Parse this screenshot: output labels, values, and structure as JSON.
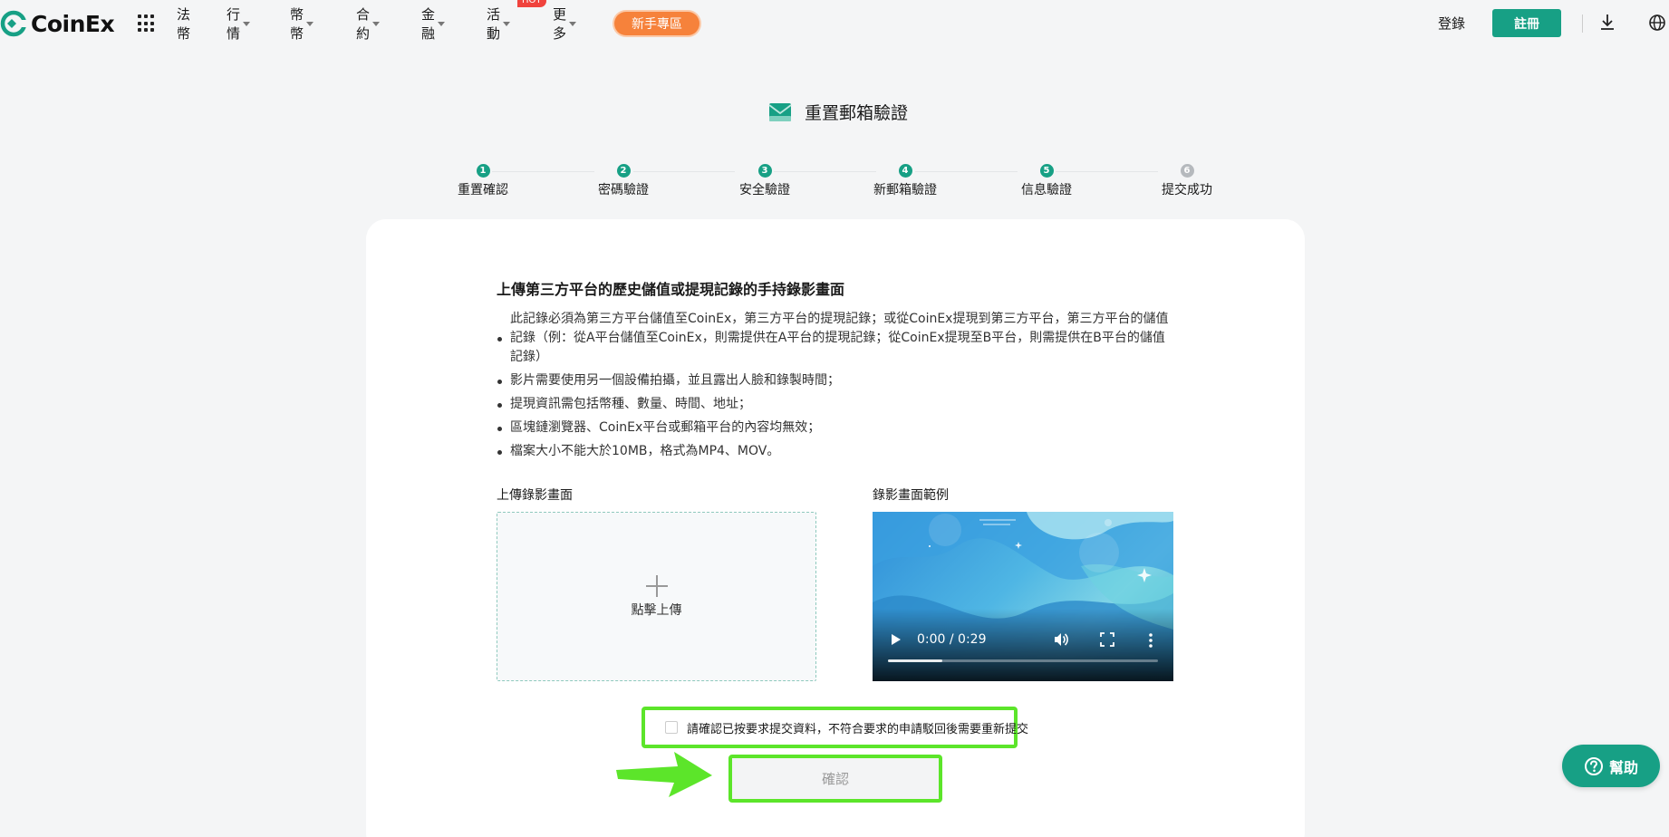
{
  "brand": {
    "name": "CoinEx",
    "accent": "#17a085",
    "highlight": "#5ce52a",
    "promo": "#f6823b"
  },
  "nav": {
    "items": [
      {
        "label": "法幣",
        "dropdown": false
      },
      {
        "label": "行情",
        "dropdown": true
      },
      {
        "label": "幣幣",
        "dropdown": true
      },
      {
        "label": "合約",
        "dropdown": true
      },
      {
        "label": "金融",
        "dropdown": true
      },
      {
        "label": "活動",
        "dropdown": true,
        "badge": "HOT"
      },
      {
        "label": "更多",
        "dropdown": true
      }
    ],
    "newbie": "新手專區",
    "login": "登錄",
    "register": "註冊"
  },
  "page": {
    "title": "重置郵箱驗證"
  },
  "steps": [
    {
      "num": "1",
      "label": "重置確認",
      "done": true
    },
    {
      "num": "2",
      "label": "密碼驗證",
      "done": true
    },
    {
      "num": "3",
      "label": "安全驗證",
      "done": true
    },
    {
      "num": "4",
      "label": "新郵箱驗證",
      "done": true
    },
    {
      "num": "5",
      "label": "信息驗證",
      "done": true
    },
    {
      "num": "6",
      "label": "提交成功",
      "done": false
    }
  ],
  "section": {
    "title": "上傳第三方平台的歷史儲值或提現記錄的手持錄影畫面",
    "rules": [
      "此記錄必須為第三方平台儲值至CoinEx，第三方平台的提現記錄；或從CoinEx提現到第三方平台，第三方平台的儲值記錄（例：從A平台儲值至CoinEx，則需提供在A平台的提現記錄；從CoinEx提現至B平台，則需提供在B平台的儲值記錄）",
      "影片需要使用另一個設備拍攝，並且露出人臉和錄製時間；",
      "提現資訊需包括幣種、數量、時間、地址；",
      "區塊鏈瀏覽器、CoinEx平台或郵箱平台的內容均無效；",
      "檔案大小不能大於10MB，格式為MP4、MOV。"
    ]
  },
  "upload": {
    "label": "上傳錄影畫面",
    "action": "點擊上傳"
  },
  "example": {
    "label": "錄影畫面範例",
    "time": "0:00 / 0:29",
    "progress": 0.2
  },
  "confirm": {
    "text": "請確認已按要求提交資料，不符合要求的申請駁回後需要重新提交",
    "checked": false
  },
  "submit": {
    "label": "確認"
  },
  "help": {
    "label": "幫助"
  }
}
